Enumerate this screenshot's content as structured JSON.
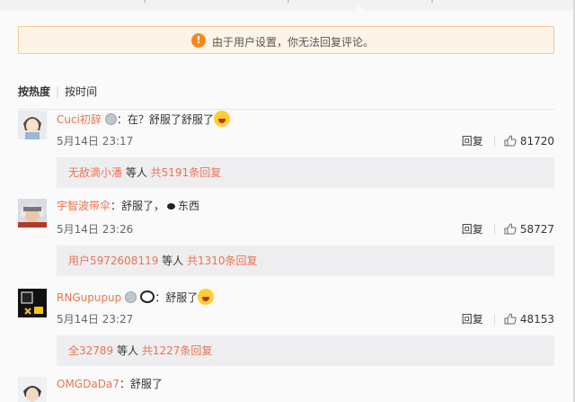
{
  "notice": {
    "text": "由于用户设置，你无法回复评论。",
    "icon": "warning-icon",
    "color": "#f28a1e"
  },
  "sort": {
    "active": "按热度",
    "other": "按时间"
  },
  "comments": [
    {
      "user": "Cuci初辞",
      "text": "：在？舒服了舒服了",
      "date": "5月14日 23:17",
      "reply_label": "回复",
      "likes": "81720",
      "sub_user": "无敌滴小潘",
      "sub_mid": " 等人 ",
      "sub_count": "共5191条回复"
    },
    {
      "user": "宇智波带伞",
      "text": "：舒服了，",
      "extra": "东西",
      "date": "5月14日 23:26",
      "reply_label": "回复",
      "likes": "58727",
      "sub_user": "用户5972608119",
      "sub_mid": " 等人 ",
      "sub_count": "共1310条回复"
    },
    {
      "user": "RNGupupup",
      "text": "：舒服了",
      "date": "5月14日 23:27",
      "reply_label": "回复",
      "likes": "48153",
      "sub_user": "全32789",
      "sub_mid": " 等人 ",
      "sub_count": "共1227条回复"
    },
    {
      "user": "OMGDaDa7",
      "text": "：舒服了"
    }
  ],
  "colors": {
    "link": "#eb7350",
    "background": "#fafafa"
  }
}
